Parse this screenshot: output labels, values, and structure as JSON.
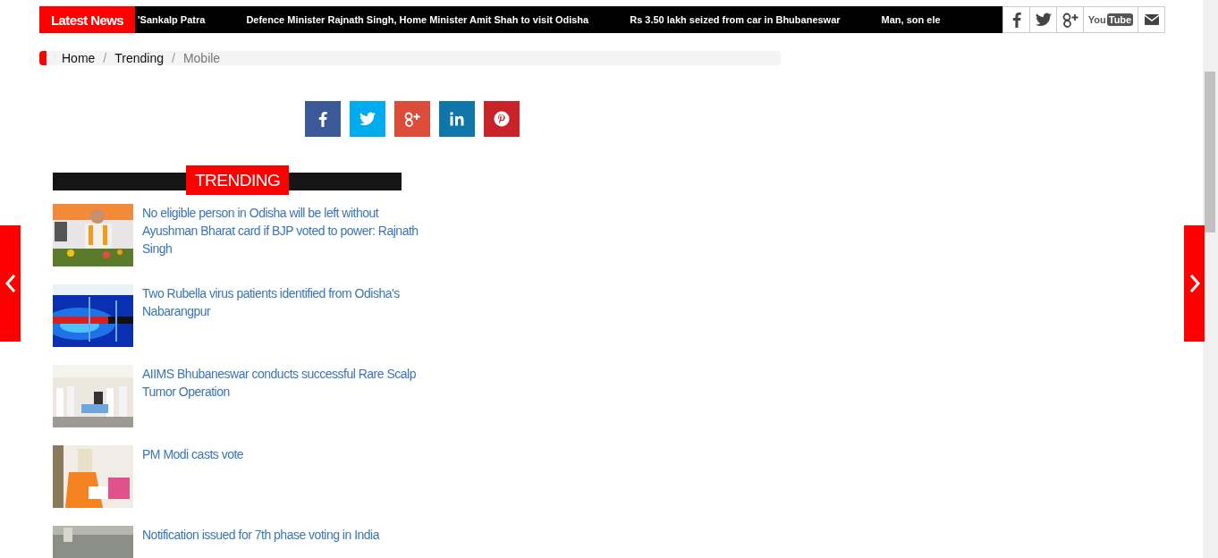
{
  "ticker": {
    "label": "Latest News",
    "items": [
      "'Sankalp Patra",
      "Defence Minister Rajnath Singh, Home Minister Amit Shah to visit Odisha",
      "Rs 3.50 lakh seized from car in Bhubaneswar",
      "Man, son ele"
    ]
  },
  "social": [
    {
      "kind": "facebook"
    },
    {
      "kind": "twitter"
    },
    {
      "kind": "googleplus"
    },
    {
      "kind": "youtube",
      "you": "You",
      "tube": "Tube"
    },
    {
      "kind": "mail"
    }
  ],
  "breadcrumb": {
    "separator": "/",
    "items": [
      {
        "label": "Home",
        "current": false
      },
      {
        "label": "Trending",
        "current": false
      },
      {
        "label": "Mobile",
        "current": true
      }
    ]
  },
  "share": [
    {
      "kind": "facebook",
      "color": "#3b5998"
    },
    {
      "kind": "twitter",
      "color": "#00aced"
    },
    {
      "kind": "googleplus",
      "color": "#dd4b39"
    },
    {
      "kind": "linkedin",
      "color": "#0e76a8"
    },
    {
      "kind": "pinterest",
      "color": "#c92228"
    }
  ],
  "section": {
    "title": "TRENDING"
  },
  "articles": [
    {
      "title": "No eligible person in Odisha will be left without Ayushman Bharat card if BJP voted to power: Rajnath Singh"
    },
    {
      "title": "Two Rubella virus patients identified from Odisha's Nabarangpur"
    },
    {
      "title": "AIIMS Bhubaneswar conducts successful Rare Scalp Tumor Operation"
    },
    {
      "title": "PM Modi casts vote"
    },
    {
      "title": "Notification issued for 7th phase voting in India"
    }
  ]
}
